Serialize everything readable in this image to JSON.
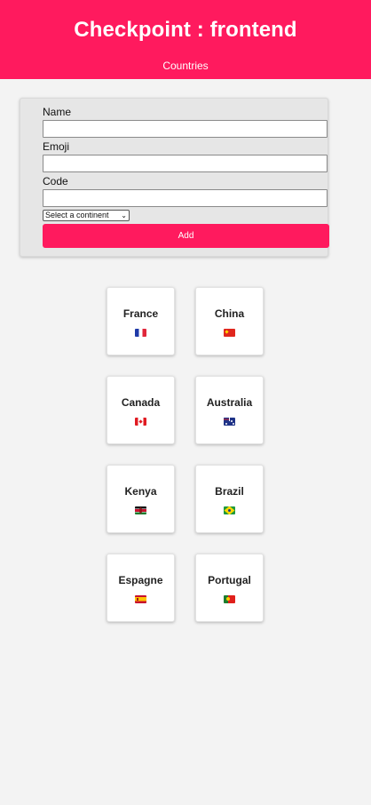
{
  "header": {
    "title": "Checkpoint : frontend",
    "nav_link": "Countries",
    "background_color": "#ff1a5e"
  },
  "form": {
    "name_label": "Name",
    "name_value": "",
    "emoji_label": "Emoji",
    "emoji_value": "",
    "code_label": "Code",
    "code_value": "",
    "continent_selected": "Select a continent",
    "add_button_label": "Add"
  },
  "countries": [
    {
      "name": "France",
      "flag_icon": "flag-france-icon"
    },
    {
      "name": "China",
      "flag_icon": "flag-china-icon"
    },
    {
      "name": "Canada",
      "flag_icon": "flag-canada-icon"
    },
    {
      "name": "Australia",
      "flag_icon": "flag-australia-icon"
    },
    {
      "name": "Kenya",
      "flag_icon": "flag-kenya-icon"
    },
    {
      "name": "Brazil",
      "flag_icon": "flag-brazil-icon"
    },
    {
      "name": "Espagne",
      "flag_icon": "flag-spain-icon"
    },
    {
      "name": "Portugal",
      "flag_icon": "flag-portugal-icon"
    }
  ]
}
